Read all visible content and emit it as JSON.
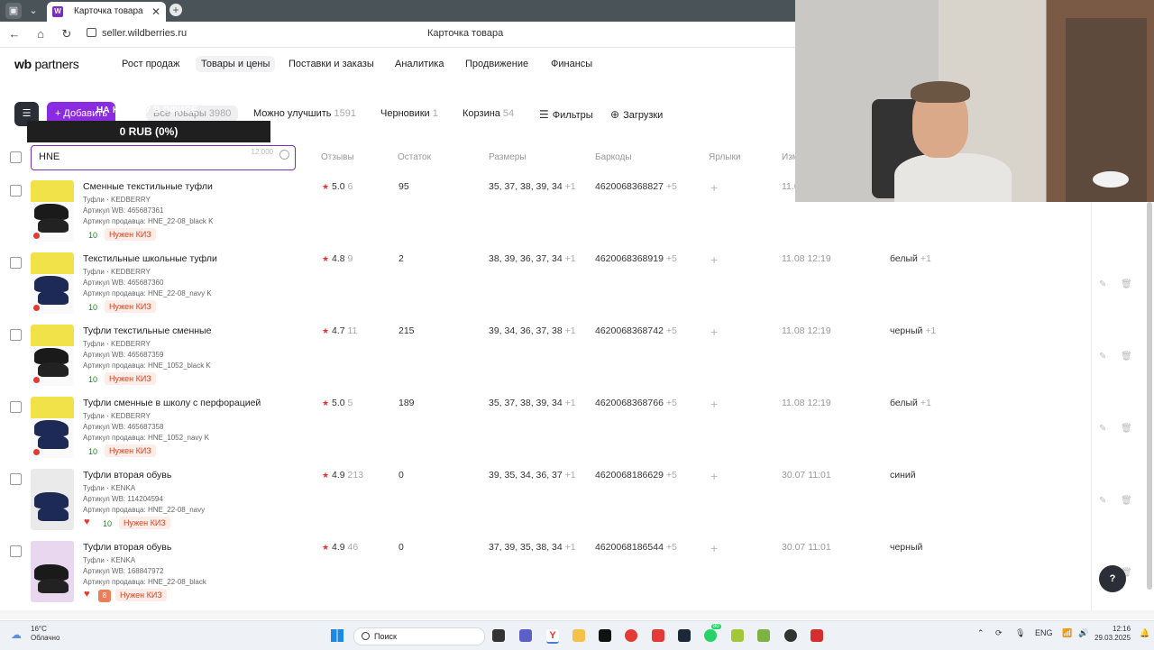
{
  "browser": {
    "tab_title": "Карточка товара",
    "tab_favicon": "W",
    "url": "seller.wildberries.ru",
    "page_title": "Карточка товара"
  },
  "header": {
    "logo_wb": "wb",
    "logo_partners": "partners",
    "menu": [
      "Рост продаж",
      "Товары и цены",
      "Поставки и заказы",
      "Аналитика",
      "Продвижение",
      "Финансы"
    ]
  },
  "toolbar": {
    "add_label": "+ Добавить",
    "banner": "НА КАМЕРУ В ОФИСЕ",
    "tooltip": "0 RUB (0%)",
    "filters": [
      {
        "label": "Все товары",
        "count": "3980"
      },
      {
        "label": "Можно улучшить",
        "count": "1591"
      },
      {
        "label": "Черновики",
        "count": "1"
      },
      {
        "label": "Корзина",
        "count": "54"
      }
    ],
    "filters_btn": "Фильтры",
    "downloads_btn": "Загрузки"
  },
  "search": {
    "value": "HNE",
    "counter": "12 000"
  },
  "columns": [
    "Отзывы",
    "Остаток",
    "Размеры",
    "Баркоды",
    "Ярлыки",
    "Изм"
  ],
  "products": [
    {
      "name": "Сменные текстильные туфли",
      "brand": "Туфли · KEDBERRY",
      "wb": "Артикул WB: 465687361",
      "seller": "Артикул продавца: HNE_22-08_black K",
      "qty": "10",
      "kiz": "Нужен КИЗ",
      "rating": "5.0",
      "reviews": "6",
      "stock": "95",
      "sizes": "35, 37, 38, 39, 34",
      "sizes_more": "+1",
      "barcode": "4620068368827",
      "barcode_more": "+5",
      "date": "11.0",
      "color": "",
      "color_more": ""
    },
    {
      "name": "Текстильные школьные туфли",
      "brand": "Туфли · KEDBERRY",
      "wb": "Артикул WB: 465687360",
      "seller": "Артикул продавца: HNE_22-08_navy K",
      "qty": "10",
      "kiz": "Нужен КИЗ",
      "rating": "4.8",
      "reviews": "9",
      "stock": "2",
      "sizes": "38, 39, 36, 37, 34",
      "sizes_more": "+1",
      "barcode": "4620068368919",
      "barcode_more": "+5",
      "date": "11.08 12:19",
      "color": "белый",
      "color_more": "+1"
    },
    {
      "name": "Туфли текстильные сменные",
      "brand": "Туфли · KEDBERRY",
      "wb": "Артикул WB: 465687359",
      "seller": "Артикул продавца: HNE_1052_black K",
      "qty": "10",
      "kiz": "Нужен КИЗ",
      "rating": "4.7",
      "reviews": "11",
      "stock": "215",
      "sizes": "39, 34, 36, 37, 38",
      "sizes_more": "+1",
      "barcode": "4620068368742",
      "barcode_more": "+5",
      "date": "11.08 12:19",
      "color": "черный",
      "color_more": "+1"
    },
    {
      "name": "Туфли сменные в школу с перфорацией",
      "brand": "Туфли · KEDBERRY",
      "wb": "Артикул WB: 465687358",
      "seller": "Артикул продавца: HNE_1052_navy K",
      "qty": "10",
      "kiz": "Нужен КИЗ",
      "rating": "5.0",
      "reviews": "5",
      "stock": "189",
      "sizes": "35, 37, 38, 39, 34",
      "sizes_more": "+1",
      "barcode": "4620068368766",
      "barcode_more": "+5",
      "date": "11.08 12:19",
      "color": "белый",
      "color_more": "+1"
    },
    {
      "name": "Туфли вторая обувь",
      "brand": "Туфли · KENKA",
      "wb": "Артикул WB: 114204594",
      "seller": "Артикул продавца: HNE_22-08_navy",
      "qty": "10",
      "kiz": "Нужен КИЗ",
      "rating": "4.9",
      "reviews": "213",
      "stock": "0",
      "sizes": "39, 35, 34, 36, 37",
      "sizes_more": "+1",
      "barcode": "4620068186629",
      "barcode_more": "+5",
      "date": "30.07 11:01",
      "color": "синий",
      "color_more": ""
    },
    {
      "name": "Туфли вторая обувь",
      "brand": "Туфли · KENKA",
      "wb": "Артикул WB: 168847972",
      "seller": "Артикул продавца: HNE_22-08_black",
      "qty": "8",
      "kiz": "Нужен КИЗ",
      "rating": "4.9",
      "reviews": "46",
      "stock": "0",
      "sizes": "37, 39, 35, 38, 34",
      "sizes_more": "+1",
      "barcode": "4620068186544",
      "barcode_more": "+5",
      "date": "30.07 11:01",
      "color": "черный",
      "color_more": ""
    }
  ],
  "help": "?",
  "taskbar": {
    "temp": "16°C",
    "weather": "Облачно",
    "search": "Поиск",
    "lang": "ENG",
    "time": "12:16",
    "date": "29.03.2025",
    "badge": "80"
  },
  "colors": {
    "accent": "#8a2be2",
    "dark": "#2b2e36",
    "kiz": "#d84315",
    "star": "#e53935"
  }
}
